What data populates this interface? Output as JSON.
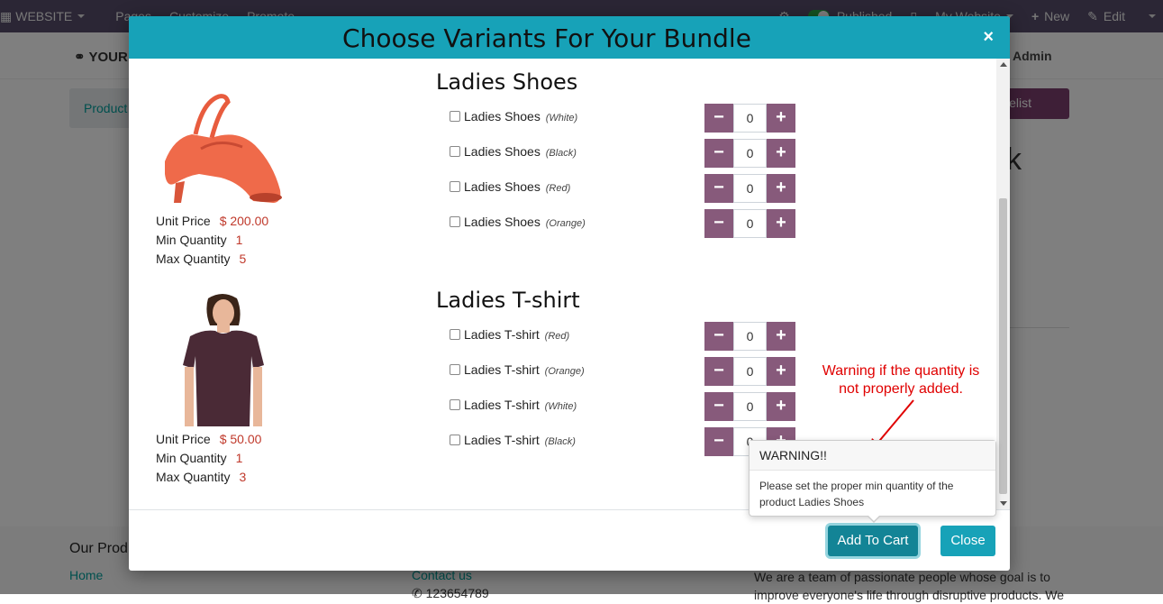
{
  "topbar": {
    "website": "WEBSITE",
    "pages": "Pages",
    "customize": "Customize",
    "promote": "Promote",
    "published": "Published",
    "my_website": "My Website",
    "new": "New",
    "edit": "Edit"
  },
  "background": {
    "logo": "YOUR",
    "admin": "Admin",
    "breadcrumb": "Product",
    "pricelist": "icelist",
    "title": "ck",
    "footer_heading": "Our Prod",
    "footer_home": "Home",
    "footer_contact": "Contact us",
    "footer_phone": "123654789",
    "footer_about": "We are a team of passionate people whose goal is to improve everyone's life through disruptive products. We"
  },
  "modal": {
    "title": "Choose Variants For Your Bundle",
    "close_x": "×",
    "add_to_cart": "Add To Cart",
    "close": "Close"
  },
  "labels": {
    "unit_price": "Unit Price",
    "min_quantity": "Min Quantity",
    "max_quantity": "Max Quantity"
  },
  "products": [
    {
      "name": "Ladies Shoes",
      "unit_price": "$ 200.00",
      "min_qty": "1",
      "max_qty": "5",
      "variants": [
        {
          "name": "Ladies Shoes",
          "attr": "(White)",
          "qty": "0"
        },
        {
          "name": "Ladies Shoes",
          "attr": "(Black)",
          "qty": "0"
        },
        {
          "name": "Ladies Shoes",
          "attr": "(Red)",
          "qty": "0"
        },
        {
          "name": "Ladies Shoes",
          "attr": "(Orange)",
          "qty": "0"
        }
      ]
    },
    {
      "name": "Ladies T-shirt",
      "unit_price": "$ 50.00",
      "min_qty": "1",
      "max_qty": "3",
      "variants": [
        {
          "name": "Ladies T-shirt",
          "attr": "(Red)",
          "qty": "0"
        },
        {
          "name": "Ladies T-shirt",
          "attr": "(Orange)",
          "qty": "0"
        },
        {
          "name": "Ladies T-shirt",
          "attr": "(White)",
          "qty": "0"
        },
        {
          "name": "Ladies T-shirt",
          "attr": "(Black)",
          "qty": "0"
        }
      ]
    }
  ],
  "qty_controls": {
    "minus": "−",
    "plus": "+"
  },
  "annotation": "Warning if the quantity is not properly added.",
  "popover": {
    "title": "WARNING!!",
    "message": "Please set the proper min quantity of the product Ladies Shoes"
  },
  "colors": {
    "topbar": "#564d6b",
    "header": "#17a2b8",
    "qty_button": "#875a7b",
    "price": "#c0392b",
    "annotation": "#e00000"
  },
  "icons": [
    "globe-icon",
    "bug-icon",
    "mobile-icon",
    "plus-icon",
    "pencil-icon",
    "apps-icon",
    "close-icon",
    "arrow-icon"
  ]
}
